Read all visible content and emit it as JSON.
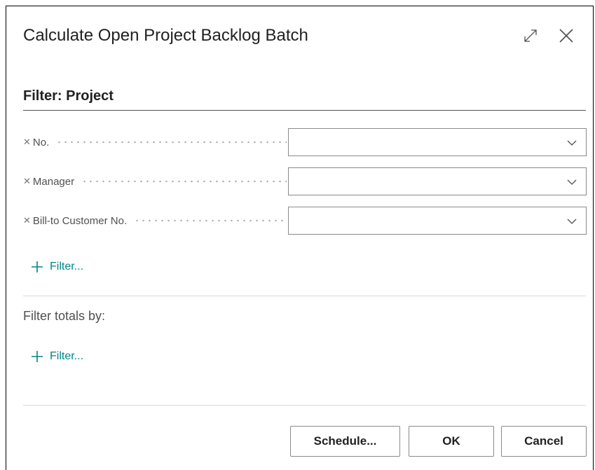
{
  "dialog": {
    "title": "Calculate Open Project Backlog Batch",
    "expand_icon": "expand-diagonal-icon",
    "close_icon": "close-icon"
  },
  "filter_section": {
    "heading": "Filter: Project",
    "fields": [
      {
        "label": "No.",
        "value": "",
        "remove_icon": "remove-x-icon",
        "dropdown_icon": "chevron-down-icon"
      },
      {
        "label": "Manager",
        "value": "",
        "remove_icon": "remove-x-icon",
        "dropdown_icon": "chevron-down-icon"
      },
      {
        "label": "Bill-to Customer No.",
        "value": "",
        "remove_icon": "remove-x-icon",
        "dropdown_icon": "chevron-down-icon"
      }
    ],
    "add_filter_label": "Filter..."
  },
  "totals_section": {
    "label": "Filter totals by:",
    "add_filter_label": "Filter..."
  },
  "buttons": {
    "schedule": "Schedule...",
    "ok": "OK",
    "cancel": "Cancel"
  },
  "colors": {
    "accent": "#008489",
    "text": "#212121",
    "muted_text": "#505050",
    "border": "#8a8a8a"
  }
}
